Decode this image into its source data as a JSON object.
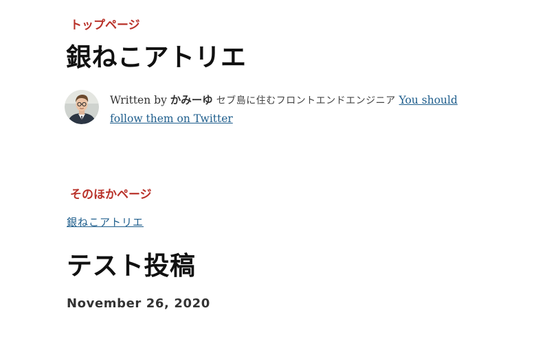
{
  "top_section": {
    "label": "トップページ",
    "site_title": "銀ねこアトリエ"
  },
  "bio": {
    "written_by": "Written by",
    "author_name": "かみーゆ",
    "tagline": "セブ島に住むフロントエンドエンジニア",
    "twitter_link": "You should follow them on Twitter"
  },
  "other_section": {
    "label": "そのほかページ",
    "link": "銀ねこアトリエ"
  },
  "post": {
    "title": "テスト投稿",
    "date": "November 26, 2020"
  },
  "colors": {
    "label_red": "#b9322a",
    "link_blue": "#1d5d8c"
  }
}
